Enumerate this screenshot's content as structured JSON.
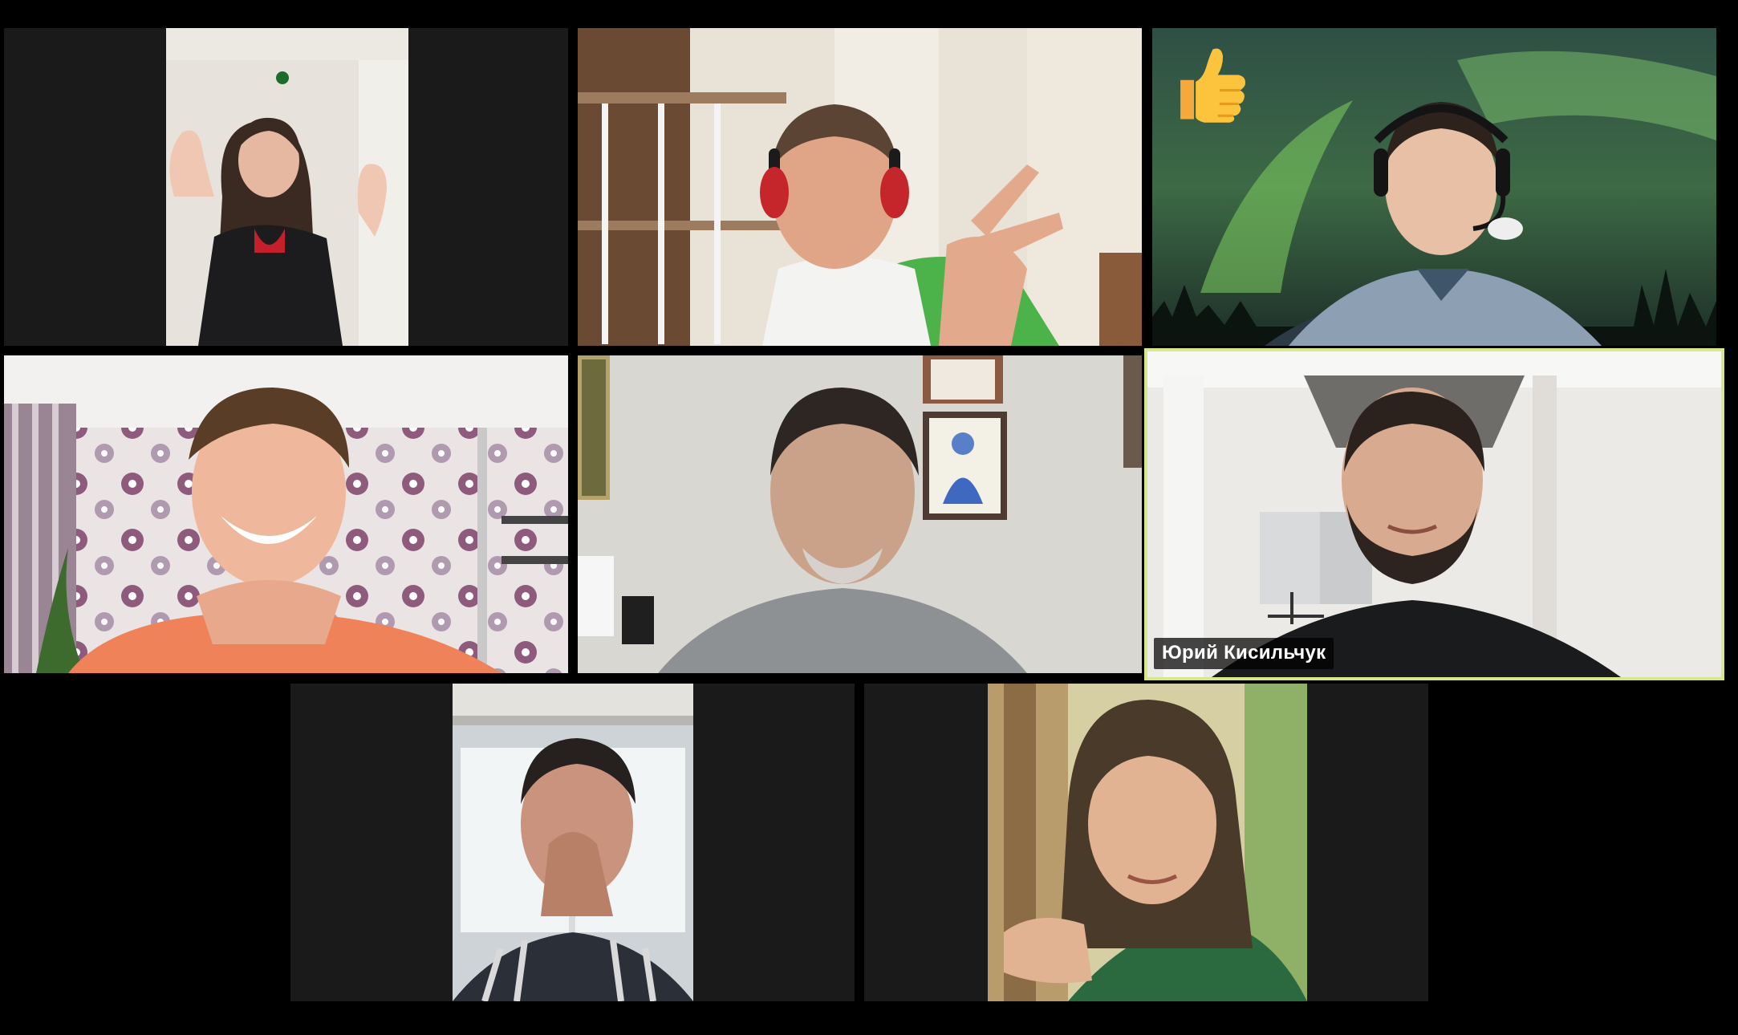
{
  "app": {
    "view": "gallery",
    "colors": {
      "background": "#000000",
      "tile_background": "#1a1a1a",
      "active_speaker_border": "#d6e88a",
      "label_background": "rgba(0,0,0,0.72)",
      "label_text": "#ffffff"
    }
  },
  "participants": [
    {
      "id": "p1",
      "name_label": "",
      "video": "woman-waving-hands"
    },
    {
      "id": "p2",
      "name_label": "",
      "video": "man-headphones-peace-sign"
    },
    {
      "id": "p3",
      "name_label": "",
      "video": "man-headset-aurora-background",
      "reaction": "thumbs-up-icon"
    },
    {
      "id": "p4",
      "name_label": "",
      "video": "man-smiling-hands-clasped"
    },
    {
      "id": "p5",
      "name_label": "",
      "video": "man-grey-shirt-paintings"
    },
    {
      "id": "p6",
      "name_label": "Юрий Кисильчук",
      "video": "man-beard-active-speaker",
      "active_speaker": true
    },
    {
      "id": "p7",
      "name_label": "",
      "video": "man-hand-on-face-window"
    },
    {
      "id": "p8",
      "name_label": "",
      "video": "woman-smiling-wooden-post"
    }
  ]
}
